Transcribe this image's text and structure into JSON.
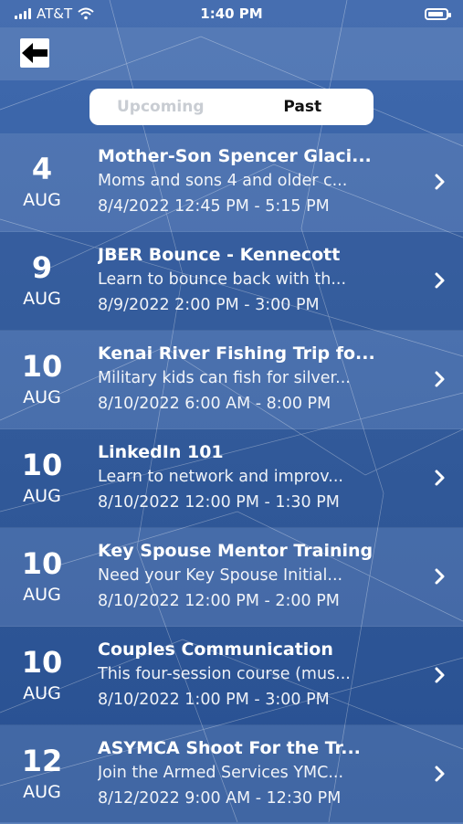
{
  "status_bar": {
    "carrier": "AT&T",
    "time": "1:40 PM"
  },
  "nav": {
    "back_icon": "arrow-left-icon"
  },
  "segments": [
    {
      "label": "Upcoming",
      "active": false
    },
    {
      "label": "Past",
      "active": true
    }
  ],
  "events": [
    {
      "day": "4",
      "month": "AUG",
      "title": "Mother-Son Spencer Glaci...",
      "description": "Moms and sons 4 and older c...",
      "time": "8/4/2022 12:45 PM - 5:15 PM"
    },
    {
      "day": "9",
      "month": "AUG",
      "title": "JBER Bounce - Kennecott",
      "description": "Learn to bounce back with th...",
      "time": "8/9/2022 2:00 PM - 3:00 PM"
    },
    {
      "day": "10",
      "month": "AUG",
      "title": "Kenai River Fishing Trip fo...",
      "description": "Military kids can fish for silver...",
      "time": "8/10/2022 6:00 AM - 8:00 PM"
    },
    {
      "day": "10",
      "month": "AUG",
      "title": "LinkedIn 101",
      "description": "Learn to network and improv...",
      "time": "8/10/2022 12:00 PM - 1:30 PM"
    },
    {
      "day": "10",
      "month": "AUG",
      "title": "Key Spouse Mentor Training",
      "description": "Need your Key Spouse Initial...",
      "time": "8/10/2022 12:00 PM - 2:00 PM"
    },
    {
      "day": "10",
      "month": "AUG",
      "title": "Couples Communication",
      "description": "This four-session course (mus...",
      "time": "8/10/2022 1:00 PM - 3:00 PM"
    },
    {
      "day": "12",
      "month": "AUG",
      "title": "ASYMCA Shoot For the Tr...",
      "description": "Join the Armed Services YMC...",
      "time": "8/12/2022 9:00 AM - 12:30 PM"
    }
  ]
}
